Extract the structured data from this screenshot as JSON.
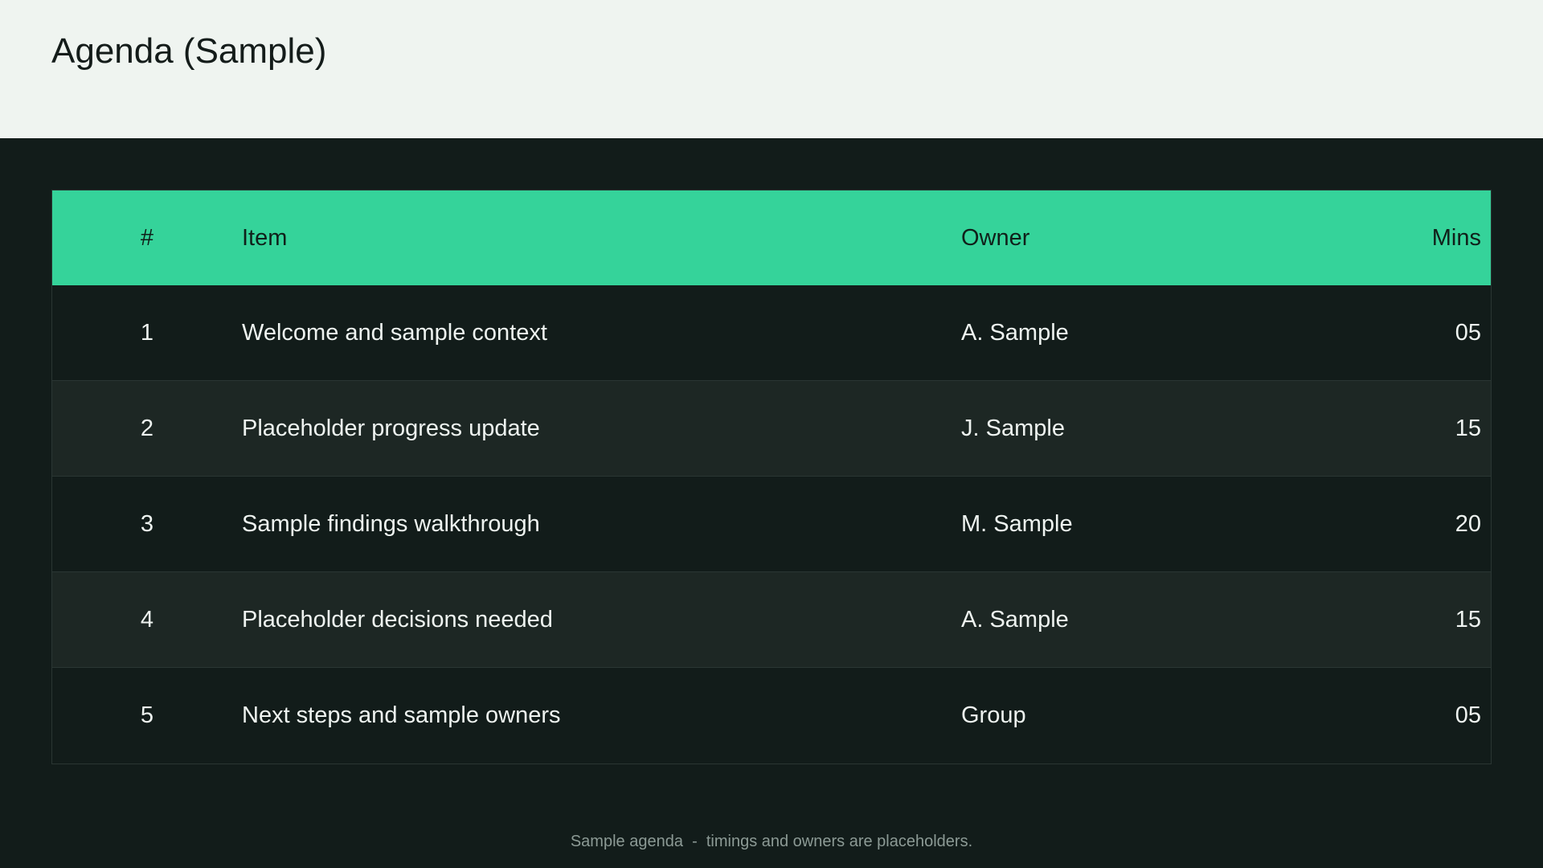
{
  "title": "Agenda (Sample)",
  "colors": {
    "header_bg": "#eff4f0",
    "page_bg": "#121c1a",
    "accent": "#35d39a",
    "row_alt": "#1d2724"
  },
  "table": {
    "headers": [
      "#",
      "Item",
      "Owner",
      "Mins"
    ],
    "rows": [
      [
        "1",
        "Welcome and sample context",
        "A. Sample",
        "05"
      ],
      [
        "2",
        "Placeholder progress update",
        "J. Sample",
        "15"
      ],
      [
        "3",
        "Sample findings walkthrough",
        "M. Sample",
        "20"
      ],
      [
        "4",
        "Placeholder decisions needed",
        "A. Sample",
        "15"
      ],
      [
        "5",
        "Next steps and sample owners",
        "Group",
        "05"
      ]
    ]
  },
  "footer": "Sample agenda  -  timings and owners are placeholders."
}
